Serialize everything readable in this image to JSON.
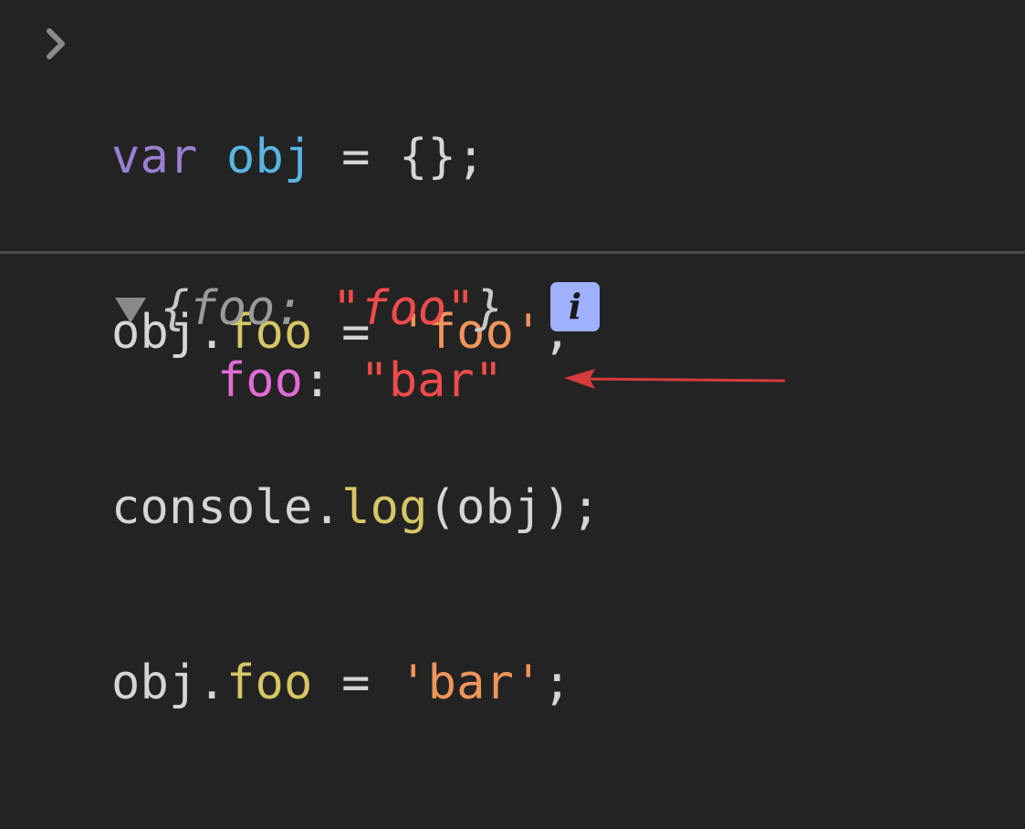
{
  "console": {
    "input": {
      "line1": {
        "kw": "var",
        "name": "obj",
        "op": "=",
        "braces": "{}",
        "semi": ";"
      },
      "line2": {
        "obj": "obj",
        "dot": ".",
        "prop": "foo",
        "op": "=",
        "str": "'foo'",
        "semi": ";"
      },
      "line3": {
        "obj": "console",
        "dot": ".",
        "method": "log",
        "args": "(obj)",
        "semi": ";"
      },
      "line4": {
        "obj": "obj",
        "dot": ".",
        "prop": "foo",
        "op": "=",
        "str": "'bar'",
        "semi": ";"
      }
    },
    "output": {
      "summary": {
        "open": "{",
        "key": "foo",
        "colon": ": ",
        "value": "\"foo\"",
        "close": "}"
      },
      "info_badge": "i",
      "property": {
        "key": "foo",
        "colon": ": ",
        "value": "\"bar\""
      }
    }
  },
  "colors": {
    "background": "#232323",
    "keyword": "#9a7fd1",
    "definition": "#58b4e3",
    "property": "#d7c665",
    "string": "#f0955b",
    "output_string": "#f04b4b",
    "output_key": "#e06bd6",
    "info_badge": "#9fb0ff",
    "annotation_arrow": "#d63a3a"
  },
  "icons": {
    "prompt": "chevron-right-icon",
    "expand": "triangle-down-icon",
    "info": "info-icon",
    "annotation": "arrow-left-icon"
  }
}
